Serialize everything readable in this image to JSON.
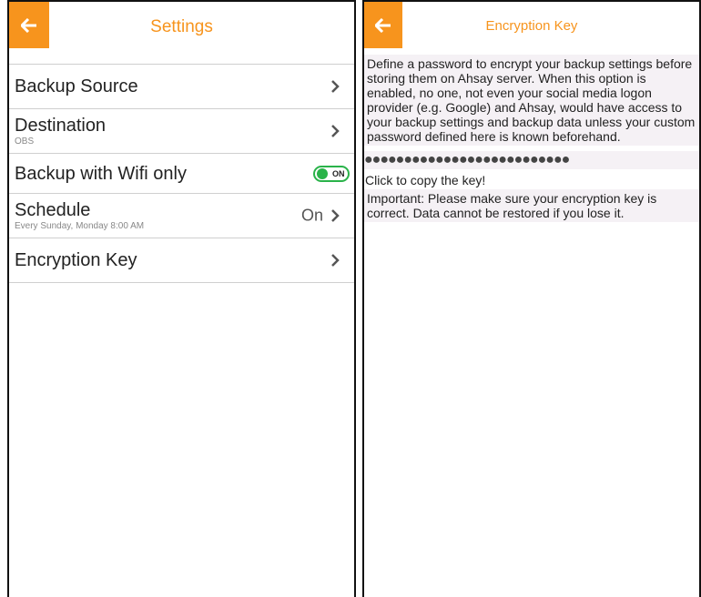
{
  "colors": {
    "accent": "#f7941d",
    "toggle_on": "#2ab34a"
  },
  "settings": {
    "title": "Settings",
    "back_icon": "arrow-left-icon",
    "rows": [
      {
        "label": "Backup Source",
        "sub": "",
        "value": ""
      },
      {
        "label": "Destination",
        "sub": "OBS",
        "value": ""
      },
      {
        "label": "Backup with Wifi only",
        "toggle": "ON"
      },
      {
        "label": "Schedule",
        "sub": "Every Sunday, Monday 8:00 AM",
        "value": "On"
      },
      {
        "label": "Encryption Key",
        "sub": "",
        "value": ""
      }
    ]
  },
  "encryption": {
    "title": "Encryption Key",
    "back_icon": "arrow-left-icon",
    "description": "Define a password to encrypt your backup settings before storing them on Ahsay server. When this option is enabled, no one, not even your social media logon provider (e.g. Google) and Ahsay, would have access to your backup settings and backup data unless your custom password defined here is known beforehand.",
    "masked_key": "●●●●●●●●●●●●●●●●●●●●●●●●●●",
    "copy_hint": "Click to copy the key!",
    "important": "Important: Please make sure your encryption key is correct. Data cannot be restored if you lose it."
  }
}
